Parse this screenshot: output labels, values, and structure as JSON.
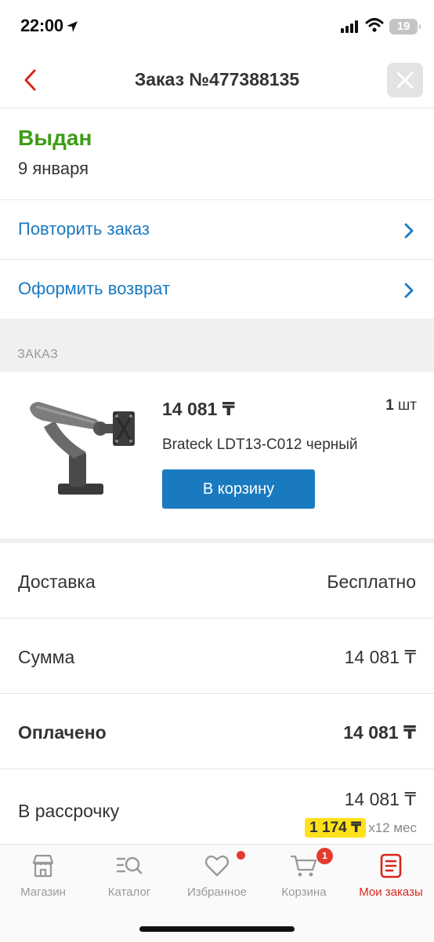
{
  "status_bar": {
    "time": "22:00",
    "battery": "19"
  },
  "header": {
    "title": "Заказ №477388135"
  },
  "order_status": {
    "title": "Выдан",
    "date": "9 января"
  },
  "actions": [
    {
      "label": "Повторить заказ"
    },
    {
      "label": "Оформить возврат"
    }
  ],
  "section": {
    "label": "ЗАКАЗ"
  },
  "product": {
    "price": "14 081 ₸",
    "qty_num": "1",
    "qty_unit": "шт",
    "name": "Brateck LDT13-C012 черный",
    "button": "В корзину"
  },
  "summary": [
    {
      "label": "Доставка",
      "value": "Бесплатно"
    },
    {
      "label": "Сумма",
      "value": "14 081 ₸"
    },
    {
      "label": "Оплачено",
      "value": "14 081 ₸"
    }
  ],
  "installment": {
    "label": "В рассрочку",
    "value": "14 081 ₸",
    "monthly": "1 174 ₸",
    "period": "x12 мес"
  },
  "tabs": [
    {
      "label": "Магазин",
      "icon": "store-icon"
    },
    {
      "label": "Каталог",
      "icon": "catalog-search-icon"
    },
    {
      "label": "Избранное",
      "icon": "heart-icon"
    },
    {
      "label": "Корзина",
      "icon": "cart-icon",
      "badge": "1"
    },
    {
      "label": "Мои заказы",
      "icon": "orders-icon"
    }
  ],
  "colors": {
    "accent_blue": "#1a7ac0",
    "status_green": "#3e9c16",
    "active_red": "#d9261c",
    "badge_yellow": "#ffe11b"
  }
}
